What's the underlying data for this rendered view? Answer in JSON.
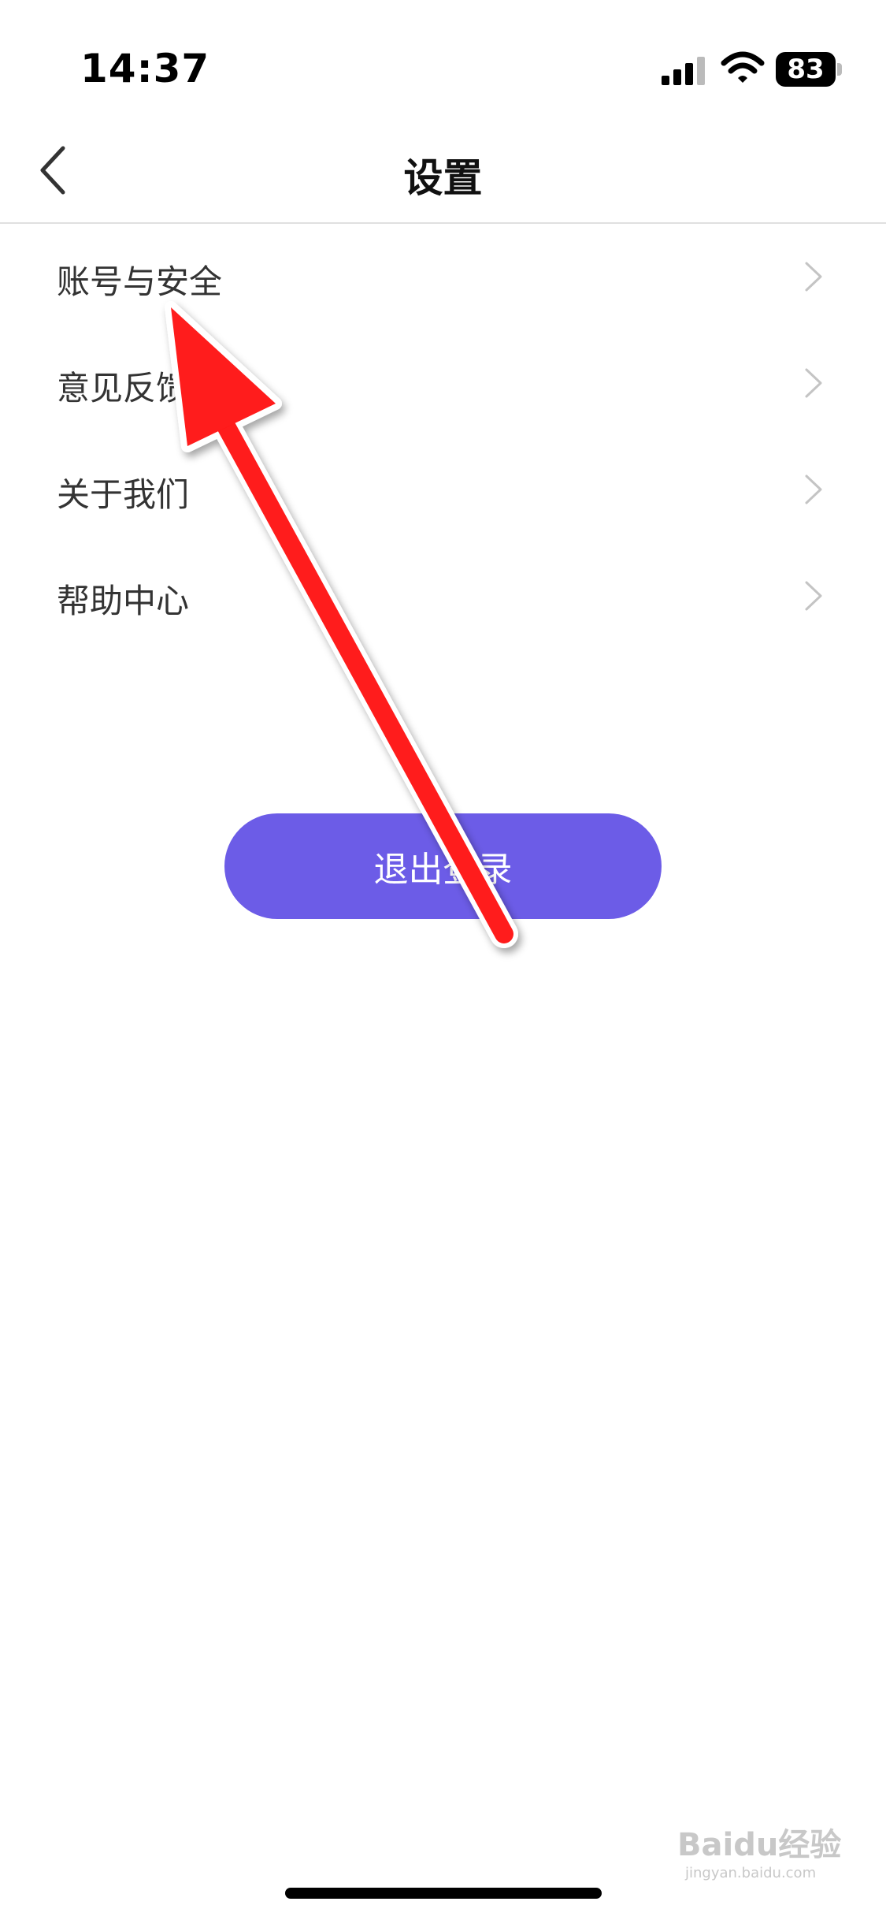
{
  "status_bar": {
    "time": "14:37",
    "battery": "83",
    "icons": [
      "signal-icon",
      "wifi-icon",
      "battery-icon"
    ]
  },
  "nav": {
    "title": "设置",
    "back_icon": "chevron-left-icon"
  },
  "settings": {
    "items": [
      {
        "label": "账号与安全",
        "icon": "chevron-right-icon"
      },
      {
        "label": "意见反馈",
        "icon": "chevron-right-icon"
      },
      {
        "label": "关于我们",
        "icon": "chevron-right-icon"
      },
      {
        "label": "帮助中心",
        "icon": "chevron-right-icon"
      }
    ]
  },
  "logout": {
    "label": "退出登录"
  },
  "annotation": {
    "type": "red-arrow",
    "color": "#ff1a1a"
  },
  "watermark": {
    "brand": "Baidu经验",
    "url": "jingyan.baidu.com"
  },
  "colors": {
    "accent": "#6c5ce7",
    "arrow": "#ff1a1a",
    "chevron": "#c4c4c4",
    "divider": "#e0e0e0"
  }
}
